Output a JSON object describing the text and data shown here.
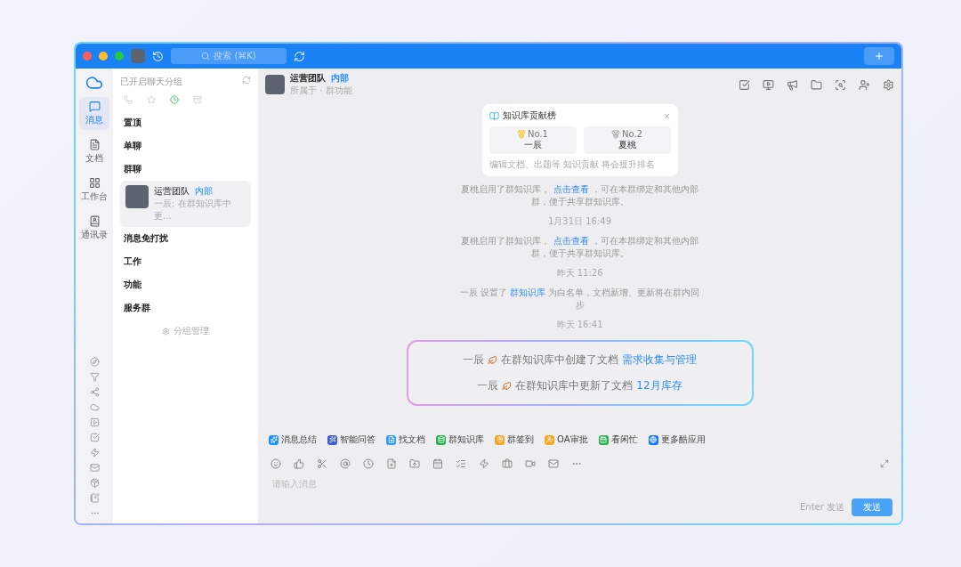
{
  "window": {
    "search_placeholder": "搜索 (⌘K)"
  },
  "rail": {
    "items": [
      {
        "label": "消息",
        "selected": true
      },
      {
        "label": "文档",
        "selected": false
      },
      {
        "label": "工作台",
        "selected": false
      },
      {
        "label": "通讯录",
        "selected": false
      }
    ]
  },
  "chat_list": {
    "header": "已开启聊天分组",
    "manage": "分组管理",
    "groups": [
      {
        "kind": "group",
        "label": "置顶"
      },
      {
        "kind": "group",
        "label": "单聊"
      },
      {
        "kind": "group",
        "label": "群聊"
      },
      {
        "kind": "chat",
        "name": "运营团队",
        "tag": "内部",
        "preview": "一辰: 在群知识库中更...",
        "selected": true
      },
      {
        "kind": "group",
        "label": "消息免打扰"
      },
      {
        "kind": "group",
        "label": "工作"
      },
      {
        "kind": "group",
        "label": "功能"
      },
      {
        "kind": "group",
        "label": "服务群"
      }
    ]
  },
  "chat": {
    "title": "运营团队",
    "tag": "内部",
    "subtitle": "所属于 · 群功能",
    "card": {
      "title": "知识库贡献榜",
      "ranks": [
        {
          "rank": "No.1",
          "name": "一辰"
        },
        {
          "rank": "No.2",
          "name": "夏桃"
        }
      ],
      "note": "编辑文档、出题等 知识贡献 将会提升排名"
    },
    "messages": [
      {
        "kind": "notice",
        "before": "夏桃启用了群知识库，",
        "link": "点击查看",
        "after": "，可在本群绑定和其他内部群，便于共享群知识库。"
      },
      {
        "kind": "time",
        "text": "1月31日 16:49"
      },
      {
        "kind": "notice",
        "before": "夏桃启用了群知识库，",
        "link": "点击查看",
        "after": "，可在本群绑定和其他内部群，便于共享群知识库。"
      },
      {
        "kind": "time",
        "text": "昨天 11:26"
      },
      {
        "kind": "notice",
        "before": "一辰 设置了",
        "link": "群知识库",
        "after": "为白名单，文档新增、更新将在群内同步"
      },
      {
        "kind": "time",
        "text": "昨天 16:41"
      },
      {
        "kind": "highlight",
        "lines": [
          {
            "actor": "一辰",
            "text": "在群知识库中创建了文档",
            "link": "需求收集与管理"
          },
          {
            "actor": "一辰",
            "text": "在群知识库中更新了文档",
            "link": "12月库存"
          }
        ]
      }
    ]
  },
  "apps": [
    {
      "label": "消息总结",
      "color": "#1e90ff"
    },
    {
      "label": "智能问答",
      "color": "#3b5bdb"
    },
    {
      "label": "找文档",
      "color": "#2f9bff"
    },
    {
      "label": "群知识库",
      "color": "#22b14c"
    },
    {
      "label": "群签到",
      "color": "#f5a623"
    },
    {
      "label": "OA审批",
      "color": "#f5a623"
    },
    {
      "label": "看闲忙",
      "color": "#22b14c"
    },
    {
      "label": "更多酷应用",
      "color": "#1677ff"
    }
  ],
  "composer": {
    "placeholder": "请输入消息",
    "hint": "Enter 发送",
    "send": "发送"
  }
}
